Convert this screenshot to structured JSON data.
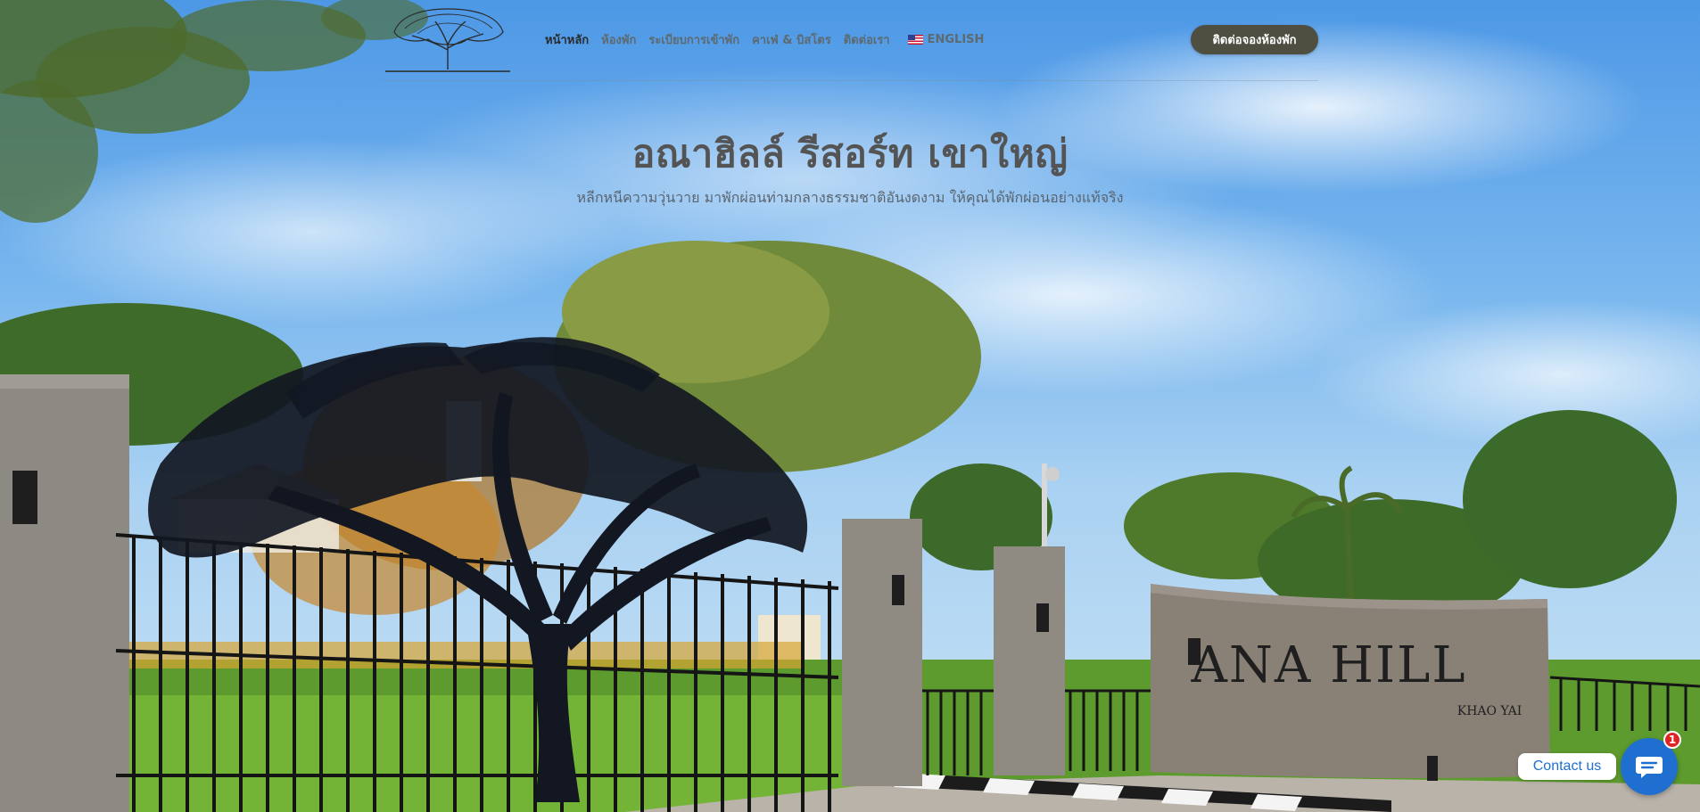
{
  "header": {
    "logo_alt": "Ana Hill tree logo",
    "nav": [
      {
        "label": "หน้าหลัก",
        "active": true
      },
      {
        "label": "ห้องพัก",
        "active": false
      },
      {
        "label": "ระเบียบการเข้าพัก",
        "active": false
      },
      {
        "label": "คาเฟ่ & บิสโตร",
        "active": false
      },
      {
        "label": "ติดต่อเรา",
        "active": false
      }
    ],
    "language": {
      "label": "ENGLISH",
      "flag_icon": "us-flag-icon"
    },
    "book_button": "ติดต่อจองห้องพัก"
  },
  "hero": {
    "title": "อณาฮิลล์ รีสอร์ท เขาใหญ่",
    "subtitle": "หลีกหนีความวุ่นวาย มาพักผ่อนท่ามกลางธรรมชาติอันงดงาม ให้คุณได้พักผ่อนอย่างแท้จริง"
  },
  "scene": {
    "sign_line1": "ANA HILL",
    "sign_line2": "KHAO YAI"
  },
  "contact": {
    "label": "Contact us",
    "badge_count": "1",
    "icon": "chat-bubble-icon"
  },
  "colors": {
    "accent": "#4e4f40",
    "nav_text": "#5e6a6f",
    "contact_blue": "#1e6fd0",
    "badge_red": "#e02424"
  }
}
